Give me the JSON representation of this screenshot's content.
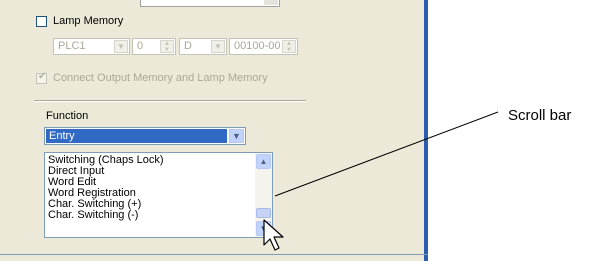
{
  "lamp_memory": {
    "label": "Lamp Memory",
    "checked": false,
    "fields": {
      "plc": "PLC1",
      "station": "0",
      "device": "D",
      "address": "00100-00"
    }
  },
  "connect_output": {
    "label": "Connect Output Memory and Lamp Memory",
    "checked": true,
    "enabled": false
  },
  "function": {
    "label": "Function",
    "selected": "Entry",
    "options": [
      "Switching (Chaps Lock)",
      "Direct Input",
      "Word Edit",
      "Word Registration",
      "Char. Switching (+)",
      "Char. Switching (-)"
    ]
  },
  "callout": {
    "label": "Scroll bar"
  },
  "icons": {
    "dropdown": "chevron-down-icon",
    "spinner": "spinner-arrows-icon",
    "scroll_up": "arrow-up-icon",
    "scroll_down": "arrow-down-icon",
    "cursor": "mouse-pointer-icon"
  }
}
